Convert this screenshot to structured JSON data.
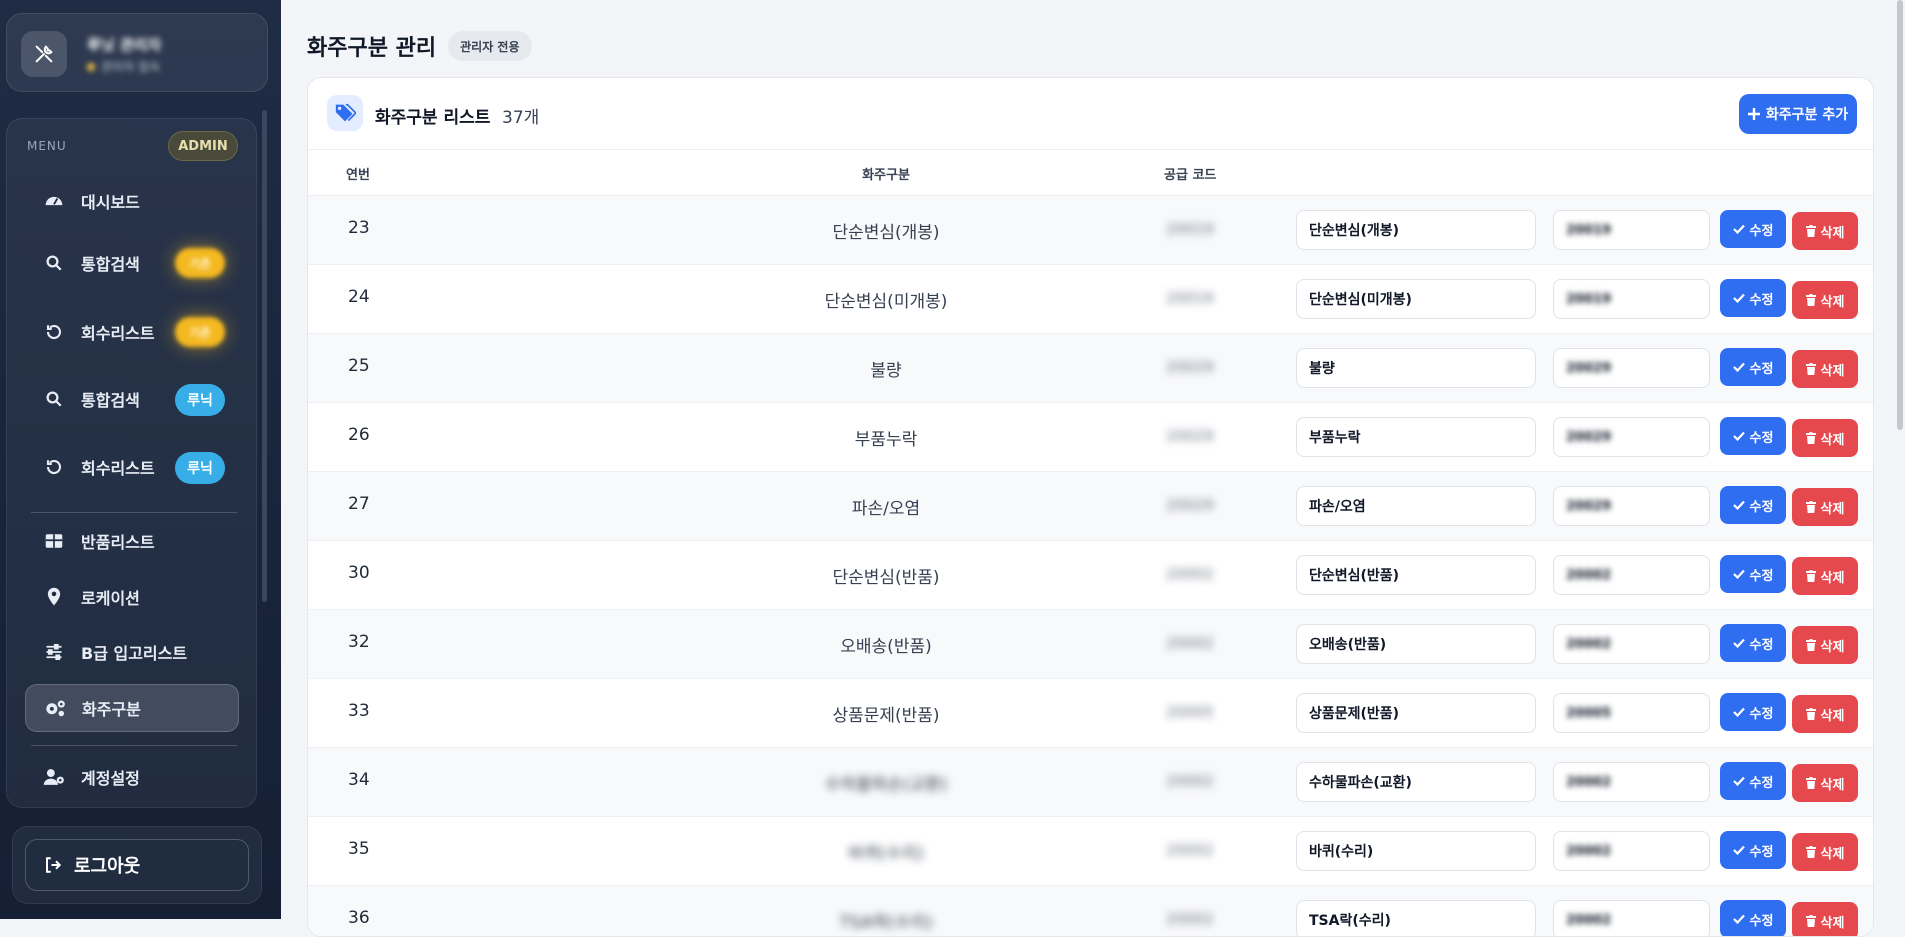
{
  "sidebar": {
    "profile": {
      "name": "루닛 관리자",
      "status": "관리자 접속"
    },
    "menu_title": "MENU",
    "admin_chip": "ADMIN",
    "items": [
      {
        "label": "대시보드",
        "icon": "dashboard-icon",
        "badge": ""
      },
      {
        "label": "통합검색",
        "icon": "search-icon",
        "badge": "기존"
      },
      {
        "label": "회수리스트",
        "icon": "history-icon",
        "badge": "기존"
      },
      {
        "label": "통합검색",
        "icon": "search-icon",
        "badge": "루닉"
      },
      {
        "label": "회수리스트",
        "icon": "history-icon",
        "badge": "루닉"
      },
      {
        "label": "반품리스트",
        "icon": "table-icon",
        "badge": ""
      },
      {
        "label": "로케이션",
        "icon": "location-icon",
        "badge": ""
      },
      {
        "label": "B급 입고리스트",
        "icon": "sliders-icon",
        "badge": ""
      },
      {
        "label": "화주구분",
        "icon": "gears-icon",
        "badge": "",
        "active": true
      },
      {
        "label": "계정설정",
        "icon": "user-gear-icon",
        "badge": ""
      }
    ],
    "logout_label": "로그아웃"
  },
  "page": {
    "title": "화주구분 관리",
    "tag": "관리자 전용"
  },
  "card": {
    "title": "화주구분 리스트",
    "count": "37개",
    "add_button": "화주구분 추가",
    "columns": {
      "num": "연번",
      "name": "화주구분",
      "code": "공급 코드"
    },
    "edit_label": "수정",
    "delete_label": "삭제",
    "rows": [
      {
        "num": "23",
        "name": "단순변심(개봉)",
        "code": "20019",
        "input_name": "단순변심(개봉)",
        "input_code": "20019"
      },
      {
        "num": "24",
        "name": "단순변심(미개봉)",
        "code": "20019",
        "input_name": "단순변심(미개봉)",
        "input_code": "20019"
      },
      {
        "num": "25",
        "name": "불량",
        "code": "20029",
        "input_name": "불량",
        "input_code": "20029"
      },
      {
        "num": "26",
        "name": "부품누락",
        "code": "20029",
        "input_name": "부품누락",
        "input_code": "20029"
      },
      {
        "num": "27",
        "name": "파손/오염",
        "code": "20029",
        "input_name": "파손/오염",
        "input_code": "20029"
      },
      {
        "num": "30",
        "name": "단순변심(반품)",
        "code": "20002",
        "input_name": "단순변심(반품)",
        "input_code": "20002"
      },
      {
        "num": "32",
        "name": "오배송(반품)",
        "code": "20002",
        "input_name": "오배송(반품)",
        "input_code": "20002"
      },
      {
        "num": "33",
        "name": "상품문제(반품)",
        "code": "20005",
        "input_name": "상품문제(반품)",
        "input_code": "20005"
      },
      {
        "num": "34",
        "name": "수하물파손(교환)",
        "code": "20002",
        "input_name": "수하물파손(교환)",
        "input_code": "20002",
        "blur_name": true
      },
      {
        "num": "35",
        "name": "바퀴(수리)",
        "code": "20002",
        "input_name": "바퀴(수리)",
        "input_code": "20002",
        "blur_name": true
      },
      {
        "num": "36",
        "name": "TSA락(수리)",
        "code": "20002",
        "input_name": "TSA락(수리)",
        "input_code": "20002",
        "blur_name": true
      }
    ]
  },
  "colors": {
    "primary": "#2f6ef0",
    "danger": "#e5484d",
    "sidebar": "#1f2c44",
    "badge_yellow": "#f4b820",
    "badge_blue": "#38aee8"
  }
}
